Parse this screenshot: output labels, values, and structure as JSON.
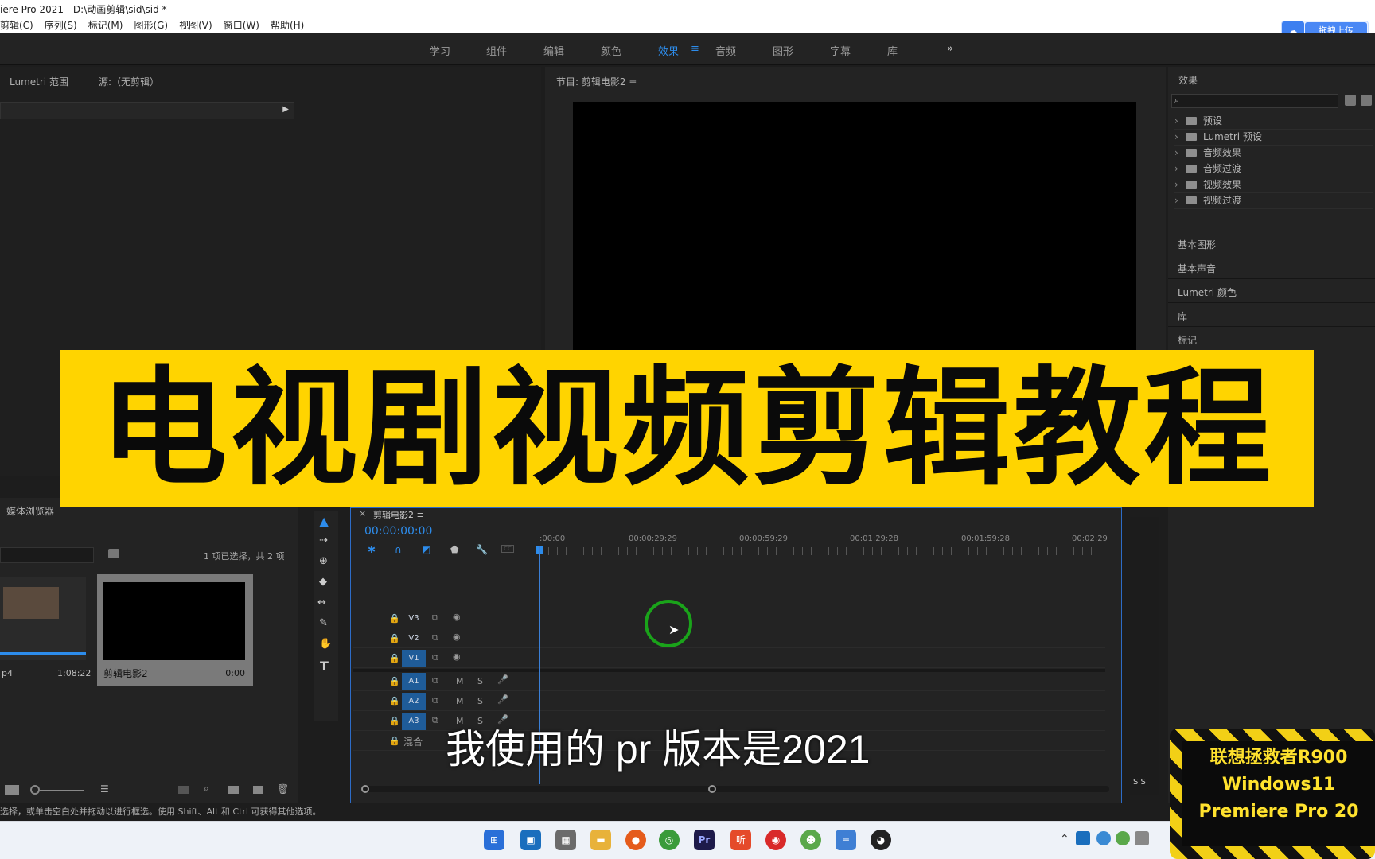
{
  "titlebar": {
    "title": "iere Pro 2021 - D:\\动画剪辑\\sid\\sid *"
  },
  "menu": [
    "剪辑(C)",
    "序列(S)",
    "标记(M)",
    "图形(G)",
    "视图(V)",
    "窗口(W)",
    "帮助(H)"
  ],
  "upload": {
    "label": "拖拽上传"
  },
  "workspace": {
    "tabs": [
      "学习",
      "组件",
      "编辑",
      "颜色",
      "效果",
      "音频",
      "图形",
      "字幕",
      "库"
    ],
    "active": "效果",
    "more": "»"
  },
  "leftPanel": {
    "tab1": "Lumetri 范围",
    "tab2": "源:（无剪辑）"
  },
  "program": {
    "title": "节目: 剪辑电影2 ≡"
  },
  "effects": {
    "title": "效果",
    "items": [
      "预设",
      "Lumetri 预设",
      "音频效果",
      "音频过渡",
      "视频效果",
      "视频过渡"
    ],
    "sections": [
      "基本图形",
      "基本声音",
      "Lumetri 颜色",
      "库",
      "标记"
    ]
  },
  "banner": {
    "text": "电视剧视频剪辑教程"
  },
  "media": {
    "tab": "媒体浏览器",
    "selection": "1 项已选择，共 2 项",
    "item1": {
      "name": "p4",
      "duration": "1:08:22"
    },
    "item2": {
      "name": "剪辑电影2",
      "duration": "0:00"
    }
  },
  "timeline": {
    "seq": "剪辑电影2 ≡",
    "timecode": "00:00:00:00",
    "ruler": [
      ":00:00",
      "00:00:29:29",
      "00:00:59:29",
      "00:01:29:28",
      "00:01:59:28",
      "00:02:29"
    ],
    "video": [
      "V3",
      "V2",
      "V1"
    ],
    "audio": [
      "A1",
      "A2",
      "A3"
    ],
    "mix": "混合",
    "m": "M",
    "s": "S",
    "vu": "S S"
  },
  "status": {
    "text": "选择，或单击空白处并拖动以进行框选。使用 Shift、Alt 和 Ctrl 可获得其他选项。"
  },
  "subtitle": {
    "text": "我使用的 pr 版本是2021"
  },
  "sticker": {
    "line1": "联想拯救者R900",
    "line2": "Windows11",
    "line3": "Premiere Pro 20"
  },
  "taskbar": {
    "pr": "Pr",
    "ting": "听"
  },
  "colors": {
    "accent": "#2d8ceb",
    "banner": "#ffd400",
    "selectBlue": "#1f5c99"
  }
}
